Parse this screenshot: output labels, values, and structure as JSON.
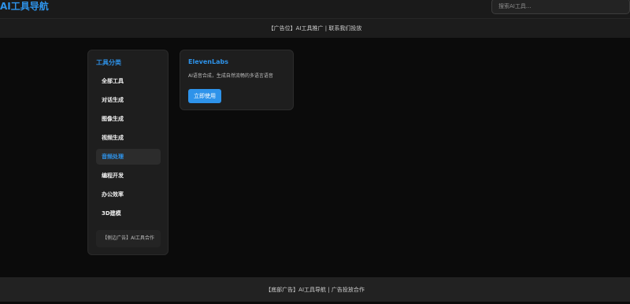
{
  "header": {
    "logo": "AI工具导航",
    "search_placeholder": "搜索AI工具..."
  },
  "ad_banner": {
    "text": "【广告位】AI工具推广 | 联系我们投放"
  },
  "sidebar": {
    "title": "工具分类",
    "items": [
      {
        "label": "全部工具",
        "active": false
      },
      {
        "label": "对话生成",
        "active": false
      },
      {
        "label": "图像生成",
        "active": false
      },
      {
        "label": "视频生成",
        "active": false
      },
      {
        "label": "音频处理",
        "active": true
      },
      {
        "label": "编程开发",
        "active": false
      },
      {
        "label": "办公效率",
        "active": false
      },
      {
        "label": "3D建模",
        "active": false
      }
    ],
    "ad_text": "【侧边广告】AI工具合作"
  },
  "tool_card": {
    "name": "ElevenLabs",
    "description": "AI语音合成，生成自然流畅的多语言语音",
    "button_label": "立即使用"
  },
  "footer": {
    "text": "【底部广告】AI工具导航 | 广告投放合作"
  },
  "colors": {
    "accent": "#2e93ea",
    "background": "#0b0b0b",
    "panel": "#1e1e1e"
  }
}
